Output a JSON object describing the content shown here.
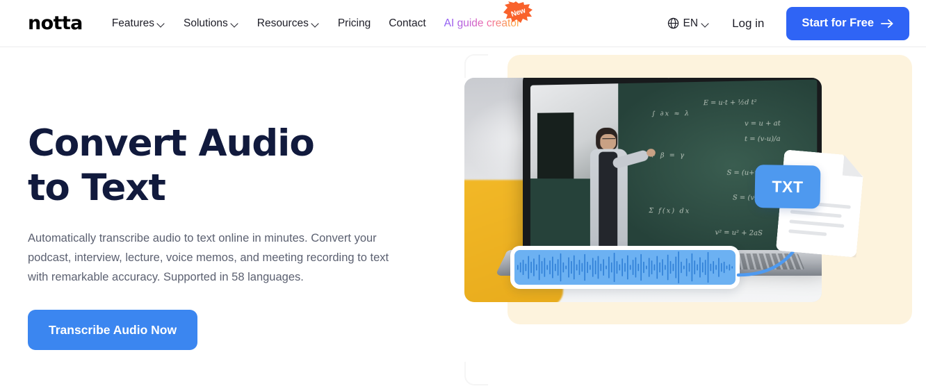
{
  "brand": {
    "logo": "notta"
  },
  "header": {
    "nav": [
      {
        "label": "Features",
        "has_dropdown": true,
        "badge": null
      },
      {
        "label": "Solutions",
        "has_dropdown": true,
        "badge": null
      },
      {
        "label": "Resources",
        "has_dropdown": true,
        "badge": null
      },
      {
        "label": "Pricing",
        "has_dropdown": false,
        "badge": null
      },
      {
        "label": "Contact",
        "has_dropdown": false,
        "badge": null
      },
      {
        "label": "AI guide creator",
        "has_dropdown": false,
        "badge": "New"
      }
    ],
    "language": {
      "code": "EN",
      "icon": "globe-icon"
    },
    "login_label": "Log in",
    "cta_label": "Start for Free",
    "cta_color": "#2f64f5"
  },
  "hero": {
    "title": "Convert Audio to Text",
    "description": "Automatically transcribe audio to text online in minutes. Convert your podcast, interview, lecture, voice memos, and meeting recording to text with remarkable accuracy. Supported in 58 languages.",
    "cta_label": "Transcribe Audio Now",
    "cta_color": "#3b86f0",
    "title_color": "#111a3d"
  },
  "illustration": {
    "panel_color": "#fdf3dd",
    "photo_alt": "teacher writing physics equations on a green chalkboard shown on a laptop screen",
    "waveform_label": "audio-waveform",
    "waveform_color": "#6cb1f2",
    "arrow_label": "conversion-arrow",
    "document": {
      "badge": "TXT",
      "badge_color": "#4e99ef"
    },
    "chalkboard_notes": [
      "E = u·t + ½d t²",
      "v = u + at",
      "t = (v-u)/a",
      "S = (u+v)/2 · t",
      "S = (v²-u²)/2a",
      "v² = u² + 2aS"
    ]
  }
}
